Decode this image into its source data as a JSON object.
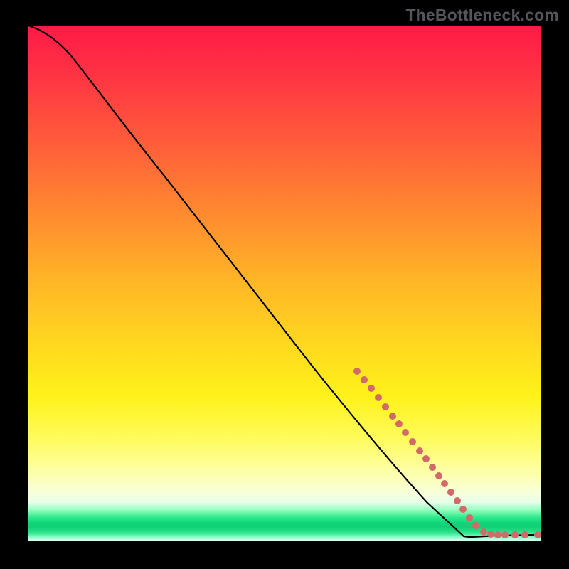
{
  "watermark": "TheBottleneck.com",
  "chart_data": {
    "type": "line",
    "title": "",
    "xlabel": "",
    "ylabel": "",
    "xlim": [
      0,
      100
    ],
    "ylim": [
      0,
      100
    ],
    "grid": false,
    "legend": false,
    "gradient_stops": [
      {
        "pos": 0.0,
        "color": "#ff1a47"
      },
      {
        "pos": 0.22,
        "color": "#ff5a3b"
      },
      {
        "pos": 0.5,
        "color": "#ffb726"
      },
      {
        "pos": 0.72,
        "color": "#fff21a"
      },
      {
        "pos": 0.9,
        "color": "#f9ffd8"
      },
      {
        "pos": 0.96,
        "color": "#0fd87a"
      },
      {
        "pos": 1.0,
        "color": "#d7fff0"
      }
    ],
    "series": [
      {
        "name": "bottleneck-curve",
        "color": "#000000",
        "x": [
          0,
          4,
          8,
          12,
          18,
          26,
          34,
          42,
          50,
          58,
          64,
          70,
          74,
          78,
          82,
          86,
          90,
          94,
          97,
          100
        ],
        "y": [
          100,
          99,
          97,
          94,
          89,
          80,
          70,
          60,
          50,
          40,
          33,
          25,
          20,
          15,
          10,
          5,
          2,
          1,
          1,
          1
        ]
      },
      {
        "name": "marker-dots",
        "color": "#d36a6a",
        "type": "scatter",
        "x": [
          64,
          65.5,
          67,
          68.5,
          70,
          71.5,
          73,
          74,
          75.5,
          77,
          78.5,
          80,
          81.5,
          83,
          84.5,
          86,
          88,
          89,
          90.5,
          92,
          93,
          95,
          96.5,
          98.5,
          100
        ],
        "y": [
          33,
          31,
          29,
          27,
          25,
          23,
          21.5,
          20,
          18.5,
          17,
          15.5,
          14,
          12.5,
          11,
          9,
          7,
          5,
          3.5,
          2,
          1.3,
          1.2,
          1.2,
          1.2,
          1.2,
          1.2
        ]
      }
    ],
    "annotations": []
  }
}
